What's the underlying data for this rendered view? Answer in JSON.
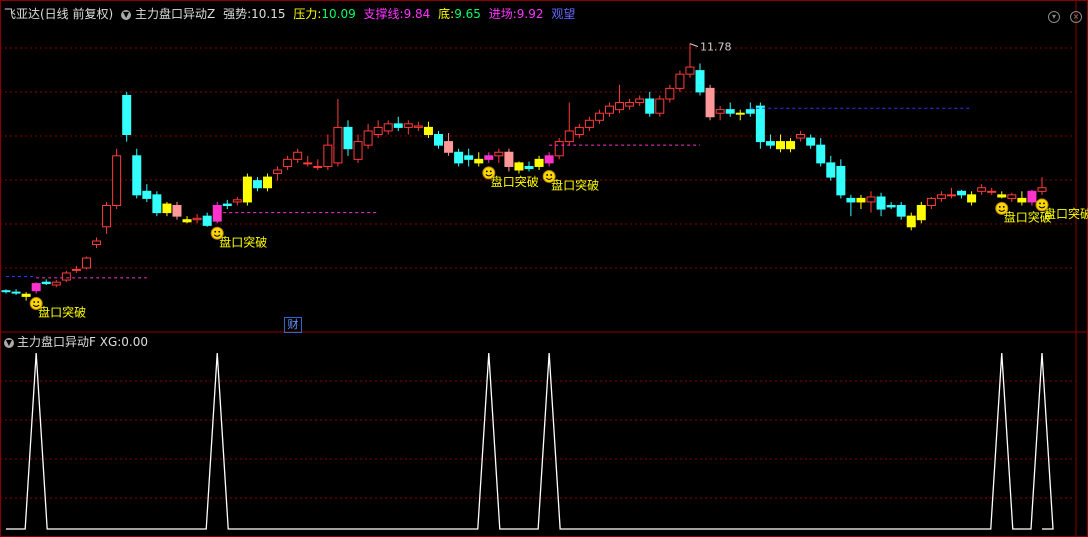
{
  "header": {
    "stock": "飞亚达(日线 前复权)",
    "indicator": "主力盘口异动Z",
    "strength_label": "强势:",
    "strength_value": "10.15",
    "pressure_label": "压力:",
    "pressure_value": "10.09",
    "support_label": "支撑线:",
    "support_value": "9.84",
    "bottom_label": "底:",
    "bottom_value": "9.65",
    "entry_label": "进场:",
    "entry_value": "9.92",
    "status": "观望"
  },
  "sub_header": {
    "indicator": "主力盘口异动F",
    "xg_label": "XG:",
    "xg_value": "0.00"
  },
  "labels": {
    "signal": "盘口突破",
    "cai": "财",
    "peak": "11.78"
  },
  "colors": {
    "up": "#ff3b3b",
    "down": "#33ffff",
    "signal_yellow": "#ffff00",
    "signal_magenta": "#ff33cc",
    "pink": "#ff9999",
    "grid": "#8b0000",
    "line": "#ffffff"
  },
  "chart_data": [
    {
      "type": "candlestick",
      "title": "飞亚达(日线 前复权)",
      "ylim": [
        8.0,
        12.0
      ],
      "peak_label": 11.78,
      "candles": [
        {
          "o": 8.3,
          "h": 8.32,
          "l": 8.26,
          "c": 8.29
        },
        {
          "o": 8.28,
          "h": 8.32,
          "l": 8.24,
          "c": 8.27
        },
        {
          "o": 8.22,
          "h": 8.28,
          "l": 8.16,
          "c": 8.25,
          "s": "y"
        },
        {
          "o": 8.3,
          "h": 8.42,
          "l": 8.26,
          "c": 8.4,
          "s": "m"
        },
        {
          "o": 8.42,
          "h": 8.46,
          "l": 8.38,
          "c": 8.4
        },
        {
          "o": 8.38,
          "h": 8.45,
          "l": 8.35,
          "c": 8.42
        },
        {
          "o": 8.45,
          "h": 8.58,
          "l": 8.42,
          "c": 8.55
        },
        {
          "o": 8.6,
          "h": 8.65,
          "l": 8.55,
          "c": 8.6
        },
        {
          "o": 8.62,
          "h": 8.78,
          "l": 8.6,
          "c": 8.76
        },
        {
          "o": 8.95,
          "h": 9.05,
          "l": 8.9,
          "c": 9.0
        },
        {
          "o": 9.2,
          "h": 9.55,
          "l": 9.1,
          "c": 9.5
        },
        {
          "o": 9.5,
          "h": 10.3,
          "l": 9.45,
          "c": 10.2
        },
        {
          "o": 11.05,
          "h": 11.1,
          "l": 10.4,
          "c": 10.5
        },
        {
          "o": 10.2,
          "h": 10.3,
          "l": 9.6,
          "c": 9.65
        },
        {
          "o": 9.7,
          "h": 9.8,
          "l": 9.55,
          "c": 9.6
        },
        {
          "o": 9.65,
          "h": 9.7,
          "l": 9.35,
          "c": 9.4
        },
        {
          "o": 9.4,
          "h": 9.55,
          "l": 9.35,
          "c": 9.52,
          "s": "y"
        },
        {
          "o": 9.5,
          "h": 9.55,
          "l": 9.3,
          "c": 9.35,
          "s": "p"
        },
        {
          "o": 9.3,
          "h": 9.35,
          "l": 9.25,
          "c": 9.27,
          "s": "y"
        },
        {
          "o": 9.3,
          "h": 9.38,
          "l": 9.25,
          "c": 9.32
        },
        {
          "o": 9.35,
          "h": 9.4,
          "l": 9.2,
          "c": 9.22
        },
        {
          "o": 9.28,
          "h": 9.55,
          "l": 9.25,
          "c": 9.5,
          "s": "m"
        },
        {
          "o": 9.52,
          "h": 9.58,
          "l": 9.45,
          "c": 9.5
        },
        {
          "o": 9.55,
          "h": 9.62,
          "l": 9.5,
          "c": 9.58
        },
        {
          "o": 9.55,
          "h": 9.95,
          "l": 9.5,
          "c": 9.9,
          "s": "y"
        },
        {
          "o": 9.85,
          "h": 9.9,
          "l": 9.7,
          "c": 9.75
        },
        {
          "o": 9.75,
          "h": 9.95,
          "l": 9.7,
          "c": 9.9,
          "s": "y"
        },
        {
          "o": 9.95,
          "h": 10.05,
          "l": 9.85,
          "c": 10.0
        },
        {
          "o": 10.05,
          "h": 10.2,
          "l": 10.0,
          "c": 10.15
        },
        {
          "o": 10.15,
          "h": 10.3,
          "l": 10.1,
          "c": 10.25
        },
        {
          "o": 10.1,
          "h": 10.2,
          "l": 10.05,
          "c": 10.1
        },
        {
          "o": 10.05,
          "h": 10.15,
          "l": 10.0,
          "c": 10.05
        },
        {
          "o": 10.05,
          "h": 10.5,
          "l": 10.0,
          "c": 10.35
        },
        {
          "o": 10.1,
          "h": 11.0,
          "l": 10.05,
          "c": 10.6
        },
        {
          "o": 10.6,
          "h": 10.7,
          "l": 10.2,
          "c": 10.3
        },
        {
          "o": 10.15,
          "h": 10.5,
          "l": 10.1,
          "c": 10.4
        },
        {
          "o": 10.35,
          "h": 10.65,
          "l": 10.3,
          "c": 10.55
        },
        {
          "o": 10.5,
          "h": 10.7,
          "l": 10.45,
          "c": 10.6
        },
        {
          "o": 10.55,
          "h": 10.7,
          "l": 10.5,
          "c": 10.65
        },
        {
          "o": 10.65,
          "h": 10.75,
          "l": 10.55,
          "c": 10.6
        },
        {
          "o": 10.6,
          "h": 10.7,
          "l": 10.5,
          "c": 10.65
        },
        {
          "o": 10.6,
          "h": 10.68,
          "l": 10.55,
          "c": 10.62
        },
        {
          "o": 10.6,
          "h": 10.68,
          "l": 10.45,
          "c": 10.5,
          "s": "y"
        },
        {
          "o": 10.5,
          "h": 10.55,
          "l": 10.3,
          "c": 10.35
        },
        {
          "o": 10.4,
          "h": 10.52,
          "l": 10.2,
          "c": 10.25,
          "s": "p"
        },
        {
          "o": 10.25,
          "h": 10.3,
          "l": 10.05,
          "c": 10.1
        },
        {
          "o": 10.2,
          "h": 10.3,
          "l": 10.05,
          "c": 10.15
        },
        {
          "o": 10.15,
          "h": 10.25,
          "l": 10.05,
          "c": 10.1,
          "s": "y"
        },
        {
          "o": 10.15,
          "h": 10.25,
          "l": 10.1,
          "c": 10.2,
          "s": "m"
        },
        {
          "o": 10.2,
          "h": 10.3,
          "l": 10.1,
          "c": 10.25
        },
        {
          "o": 10.05,
          "h": 10.3,
          "l": 9.98,
          "c": 10.25,
          "s": "p"
        },
        {
          "o": 10.0,
          "h": 10.12,
          "l": 9.95,
          "c": 10.1,
          "s": "y"
        },
        {
          "o": 10.05,
          "h": 10.12,
          "l": 9.98,
          "c": 10.02
        },
        {
          "o": 10.05,
          "h": 10.2,
          "l": 10.0,
          "c": 10.15,
          "s": "y"
        },
        {
          "o": 10.1,
          "h": 10.25,
          "l": 10.05,
          "c": 10.2,
          "s": "m"
        },
        {
          "o": 10.2,
          "h": 10.45,
          "l": 10.15,
          "c": 10.4
        },
        {
          "o": 10.4,
          "h": 10.95,
          "l": 10.35,
          "c": 10.55
        },
        {
          "o": 10.5,
          "h": 10.65,
          "l": 10.45,
          "c": 10.6
        },
        {
          "o": 10.6,
          "h": 10.75,
          "l": 10.55,
          "c": 10.7
        },
        {
          "o": 10.7,
          "h": 10.85,
          "l": 10.65,
          "c": 10.8
        },
        {
          "o": 10.8,
          "h": 10.95,
          "l": 10.75,
          "c": 10.9
        },
        {
          "o": 10.85,
          "h": 11.2,
          "l": 10.8,
          "c": 10.95
        },
        {
          "o": 10.9,
          "h": 11.0,
          "l": 10.85,
          "c": 10.95
        },
        {
          "o": 10.95,
          "h": 11.05,
          "l": 10.9,
          "c": 11.0
        },
        {
          "o": 11.0,
          "h": 11.1,
          "l": 10.75,
          "c": 10.8
        },
        {
          "o": 10.8,
          "h": 11.05,
          "l": 10.75,
          "c": 11.0
        },
        {
          "o": 11.0,
          "h": 11.2,
          "l": 10.95,
          "c": 11.15
        },
        {
          "o": 11.15,
          "h": 11.4,
          "l": 11.1,
          "c": 11.35
        },
        {
          "o": 11.35,
          "h": 11.78,
          "l": 11.3,
          "c": 11.45
        },
        {
          "o": 11.4,
          "h": 11.5,
          "l": 11.05,
          "c": 11.1
        },
        {
          "o": 11.15,
          "h": 11.2,
          "l": 10.7,
          "c": 10.75,
          "s": "p"
        },
        {
          "o": 10.8,
          "h": 10.9,
          "l": 10.7,
          "c": 10.85
        },
        {
          "o": 10.85,
          "h": 10.95,
          "l": 10.75,
          "c": 10.8
        },
        {
          "o": 10.8,
          "h": 10.85,
          "l": 10.7,
          "c": 10.8,
          "s": "y"
        },
        {
          "o": 10.85,
          "h": 10.95,
          "l": 10.75,
          "c": 10.8
        },
        {
          "o": 10.9,
          "h": 10.95,
          "l": 10.3,
          "c": 10.4
        },
        {
          "o": 10.4,
          "h": 10.5,
          "l": 10.3,
          "c": 10.35
        },
        {
          "o": 10.4,
          "h": 10.5,
          "l": 10.25,
          "c": 10.3,
          "s": "y"
        },
        {
          "o": 10.3,
          "h": 10.45,
          "l": 10.25,
          "c": 10.4,
          "s": "y"
        },
        {
          "o": 10.45,
          "h": 10.55,
          "l": 10.4,
          "c": 10.5
        },
        {
          "o": 10.45,
          "h": 10.5,
          "l": 10.3,
          "c": 10.35
        },
        {
          "o": 10.35,
          "h": 10.45,
          "l": 10.05,
          "c": 10.1
        },
        {
          "o": 10.1,
          "h": 10.2,
          "l": 9.85,
          "c": 9.9
        },
        {
          "o": 10.05,
          "h": 10.15,
          "l": 9.6,
          "c": 9.65
        },
        {
          "o": 9.6,
          "h": 9.65,
          "l": 9.35,
          "c": 9.55
        },
        {
          "o": 9.55,
          "h": 9.65,
          "l": 9.45,
          "c": 9.6,
          "s": "y"
        },
        {
          "o": 9.55,
          "h": 9.7,
          "l": 9.4,
          "c": 9.62
        },
        {
          "o": 9.62,
          "h": 9.68,
          "l": 9.35,
          "c": 9.45
        },
        {
          "o": 9.5,
          "h": 9.55,
          "l": 9.45,
          "c": 9.48
        },
        {
          "o": 9.5,
          "h": 9.55,
          "l": 9.3,
          "c": 9.35
        },
        {
          "o": 9.35,
          "h": 9.4,
          "l": 9.15,
          "c": 9.2,
          "s": "y"
        },
        {
          "o": 9.3,
          "h": 9.55,
          "l": 9.25,
          "c": 9.5,
          "s": "y"
        },
        {
          "o": 9.5,
          "h": 9.62,
          "l": 9.45,
          "c": 9.6
        },
        {
          "o": 9.6,
          "h": 9.7,
          "l": 9.55,
          "c": 9.65
        },
        {
          "o": 9.65,
          "h": 9.75,
          "l": 9.6,
          "c": 9.65
        },
        {
          "o": 9.7,
          "h": 9.72,
          "l": 9.6,
          "c": 9.65
        },
        {
          "o": 9.55,
          "h": 9.7,
          "l": 9.5,
          "c": 9.65,
          "s": "y"
        },
        {
          "o": 9.7,
          "h": 9.8,
          "l": 9.65,
          "c": 9.75
        },
        {
          "o": 9.7,
          "h": 9.75,
          "l": 9.65,
          "c": 9.7
        },
        {
          "o": 9.65,
          "h": 9.7,
          "l": 9.6,
          "c": 9.62,
          "s": "y"
        },
        {
          "o": 9.6,
          "h": 9.68,
          "l": 9.55,
          "c": 9.65
        },
        {
          "o": 9.6,
          "h": 9.7,
          "l": 9.5,
          "c": 9.55,
          "s": "y"
        },
        {
          "o": 9.55,
          "h": 9.72,
          "l": 9.5,
          "c": 9.7,
          "s": "m"
        },
        {
          "o": 9.7,
          "h": 9.9,
          "l": 9.65,
          "c": 9.75
        }
      ],
      "signals": [
        3,
        21,
        48,
        54,
        99,
        103
      ]
    },
    {
      "type": "line",
      "title": "主力盘口异动F",
      "ylim": [
        0,
        1
      ],
      "series": [
        {
          "name": "XG",
          "peak_indices": [
            3,
            21,
            48,
            54,
            99,
            103
          ]
        }
      ]
    }
  ]
}
